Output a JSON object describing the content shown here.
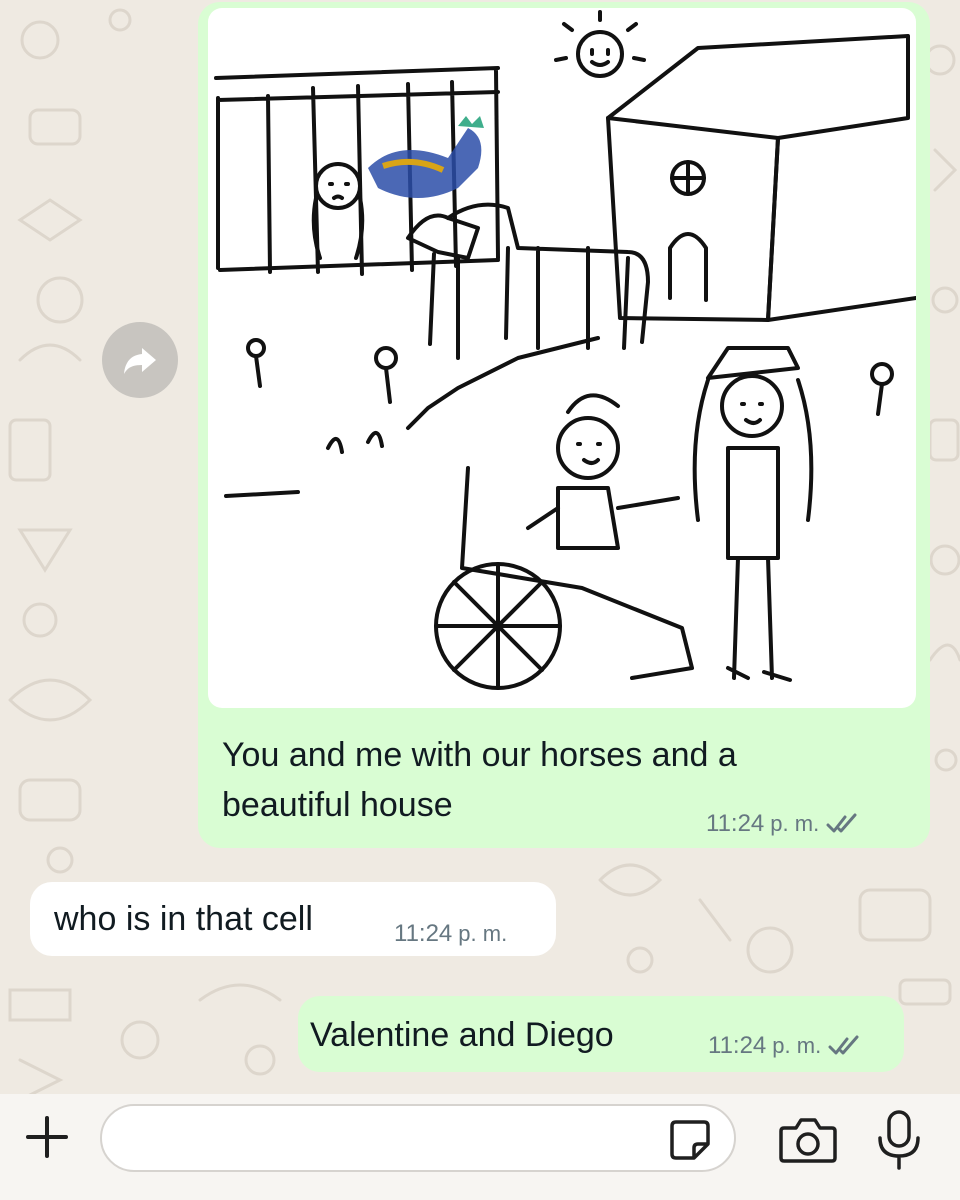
{
  "chat": {
    "messages": [
      {
        "direction": "outgoing",
        "type": "image",
        "caption": "You and me with our horses and a beautiful house",
        "time": "11:24",
        "time_suffix": "p. m.",
        "status": "read"
      },
      {
        "direction": "incoming",
        "type": "text",
        "text": "who is in that cell",
        "time": "11:24",
        "time_suffix": "p. m."
      },
      {
        "direction": "outgoing",
        "type": "text",
        "text": "Valentine and Diego",
        "time": "11:24",
        "time_suffix": "p. m.",
        "status": "read"
      }
    ]
  },
  "composer": {
    "placeholder": "",
    "icons": [
      "plus-icon",
      "sticker-icon",
      "camera-icon",
      "microphone-icon"
    ]
  },
  "colors": {
    "background": "#efeae2",
    "outgoing_bubble": "#d9fdd3",
    "incoming_bubble": "#ffffff",
    "meta_text": "#667781",
    "read_ticks": "#667781"
  }
}
